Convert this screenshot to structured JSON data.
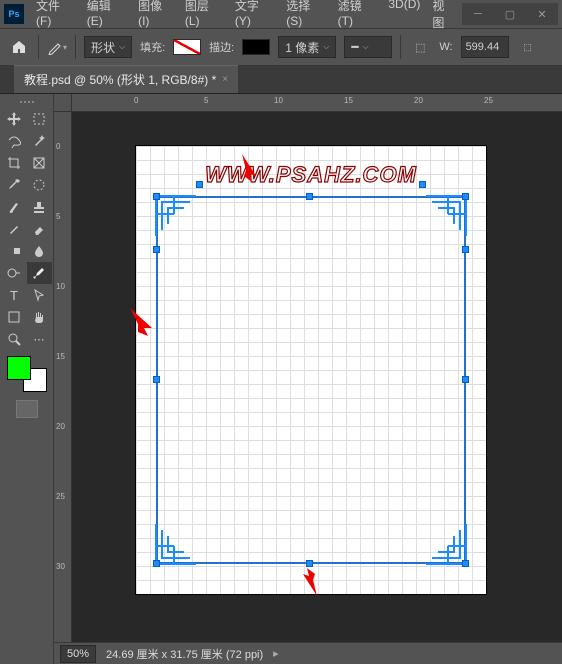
{
  "titlebar": {
    "menus": [
      "文件(F)",
      "编辑(E)",
      "图像(I)",
      "图层(L)",
      "文字(Y)",
      "选择(S)",
      "滤镜(T)",
      "3D(D)",
      "视图"
    ]
  },
  "options": {
    "mode_label": "形状",
    "fill_label": "填充:",
    "stroke_label": "描边:",
    "stroke_width": "1 像素",
    "w_label": "W:",
    "w_value": "599.44"
  },
  "doctab": {
    "label": "教程.psd @ 50% (形状 1, RGB/8#) *"
  },
  "ruler_h": {
    "t0": "0",
    "t1": "5",
    "t2": "10",
    "t3": "15",
    "t4": "20",
    "t5": "25"
  },
  "ruler_v": {
    "t0": "0",
    "t1": "5",
    "t2": "10",
    "t3": "15",
    "t4": "20",
    "t5": "25",
    "t6": "30"
  },
  "canvas": {
    "watermark": "WWW.PSAHZ.COM"
  },
  "status": {
    "zoom": "50%",
    "docsize": "24.69 厘米 x 31.75 厘米 (72 ppi)"
  }
}
